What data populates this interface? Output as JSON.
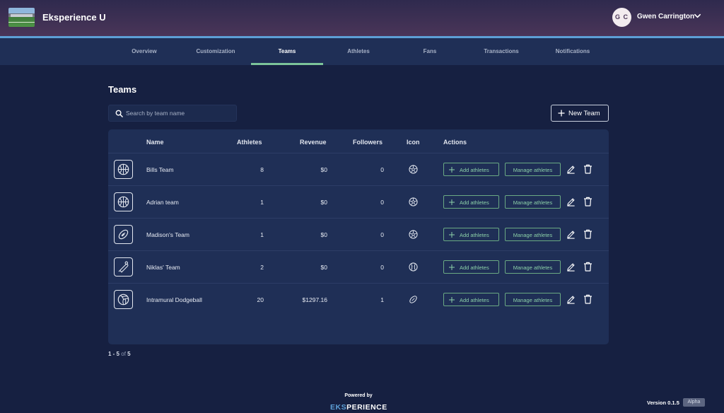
{
  "app": {
    "title": "Eksperience U"
  },
  "user": {
    "initials": "G C",
    "name": "Gwen Carrington"
  },
  "nav": {
    "tabs": [
      {
        "label": "Overview"
      },
      {
        "label": "Customization"
      },
      {
        "label": "Teams",
        "active": true
      },
      {
        "label": "Athletes"
      },
      {
        "label": "Fans"
      },
      {
        "label": "Transactions"
      },
      {
        "label": "Notifications"
      }
    ]
  },
  "page": {
    "title": "Teams"
  },
  "search": {
    "placeholder": "Search by team name",
    "value": ""
  },
  "toolbar": {
    "new_team_label": "New Team"
  },
  "table": {
    "headers": {
      "name": "Name",
      "athletes": "Athletes",
      "revenue": "Revenue",
      "followers": "Followers",
      "icon": "Icon",
      "actions": "Actions"
    },
    "add_athletes_label": "Add athletes",
    "manage_athletes_label": "Manage athletes",
    "rows": [
      {
        "team_icon": "basketball-icon",
        "name": "Bills Team",
        "athletes": "8",
        "revenue": "$0",
        "followers": "0",
        "sport_icon": "soccer-ball-icon"
      },
      {
        "team_icon": "basketball-icon",
        "name": "Adrian team",
        "athletes": "1",
        "revenue": "$0",
        "followers": "0",
        "sport_icon": "soccer-ball-icon"
      },
      {
        "team_icon": "football-icon",
        "name": "Madison's Team",
        "athletes": "1",
        "revenue": "$0",
        "followers": "0",
        "sport_icon": "soccer-ball-icon"
      },
      {
        "team_icon": "baseball-bat-icon",
        "name": "Niklas' Team",
        "athletes": "2",
        "revenue": "$0",
        "followers": "0",
        "sport_icon": "baseball-icon"
      },
      {
        "team_icon": "volleyball-icon",
        "name": "Intramural Dodgeball",
        "athletes": "20",
        "revenue": "$1297.16",
        "followers": "1",
        "sport_icon": "football-icon"
      }
    ]
  },
  "pagination": {
    "range": "1 - 5",
    "of": "of",
    "total": "5"
  },
  "footer": {
    "powered_by": "Powered by",
    "brand_prefix": "EKS",
    "brand_rest": "PERIENCE",
    "version": "Version 0.1.5",
    "badge": "Alpha"
  },
  "colors": {
    "accent": "#7cc49a",
    "header_line": "#5d9fd6",
    "background": "#162041",
    "card": "#1f2f56"
  }
}
